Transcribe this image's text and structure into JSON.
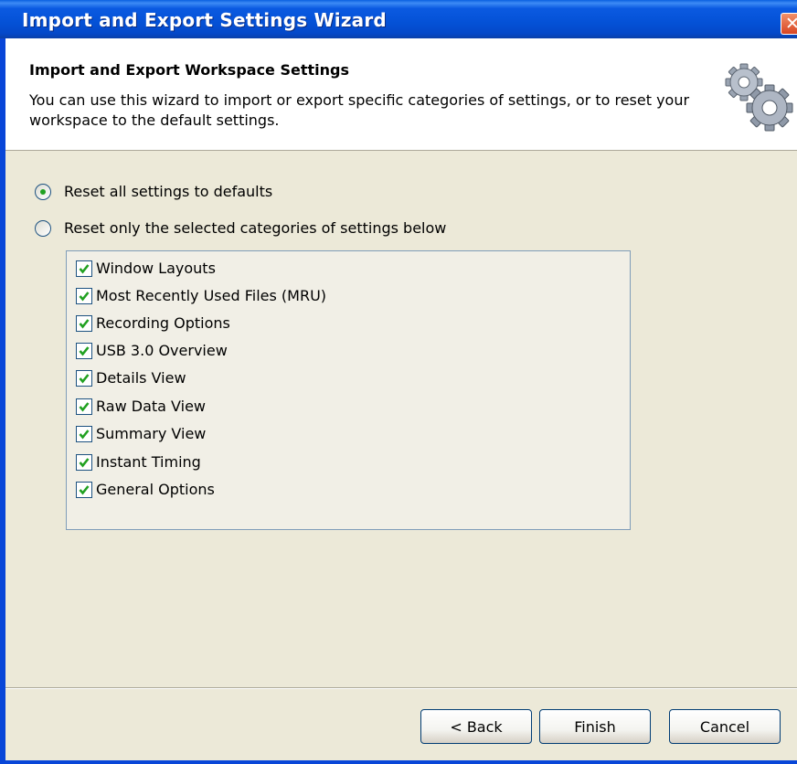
{
  "window": {
    "title": "Import and Export Settings Wizard"
  },
  "header": {
    "title": "Import and Export Workspace Settings",
    "description": "You can use this wizard to import or export specific categories of settings, or to reset your workspace to the default settings."
  },
  "options": [
    {
      "label": "Reset all settings to defaults",
      "checked": true
    },
    {
      "label": "Reset only the selected categories of settings below",
      "checked": false
    }
  ],
  "categories": [
    {
      "label": "Window Layouts",
      "checked": true
    },
    {
      "label": "Most Recently Used Files (MRU)",
      "checked": true
    },
    {
      "label": "Recording Options",
      "checked": true
    },
    {
      "label": "USB 3.0 Overview",
      "checked": true
    },
    {
      "label": "Details View",
      "checked": true
    },
    {
      "label": "Raw Data View",
      "checked": true
    },
    {
      "label": "Summary View",
      "checked": true
    },
    {
      "label": "Instant Timing",
      "checked": true
    },
    {
      "label": "General Options",
      "checked": true
    }
  ],
  "buttons": {
    "back": "< Back",
    "finish": "Finish",
    "cancel": "Cancel"
  },
  "colors": {
    "titlebar": "#0451d6",
    "checkmark": "#21a121",
    "background": "#ece9d8"
  },
  "icons": {
    "header": "gears-icon",
    "close": "close-icon"
  }
}
